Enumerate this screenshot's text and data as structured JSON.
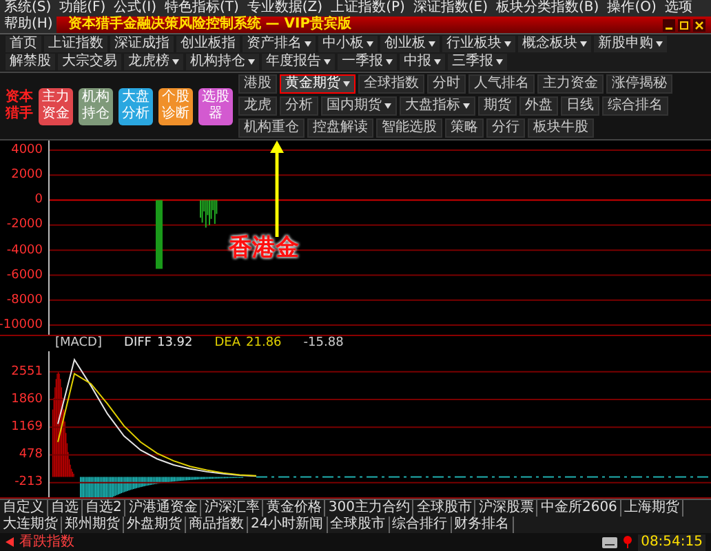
{
  "menu": [
    "系统(S)",
    "功能(F)",
    "公式(I)",
    "特色指标(T)",
    "专业数据(Z)",
    "上证指数(P)",
    "深证指数(E)",
    "板块分类指数(B)",
    "操作(O)",
    "选项",
    "帮助(H)"
  ],
  "window": {
    "title": "资本猎手金融决策风险控制系统 — VIP贵宾版"
  },
  "nav": [
    {
      "label": "首页",
      "dropdown": false
    },
    {
      "label": "上证指数",
      "dropdown": false
    },
    {
      "label": "深证成指",
      "dropdown": false
    },
    {
      "label": "创业板指",
      "dropdown": false
    },
    {
      "label": "资产排名",
      "dropdown": true
    },
    {
      "label": "中小板",
      "dropdown": true
    },
    {
      "label": "创业板",
      "dropdown": true
    },
    {
      "label": "行业板块",
      "dropdown": true
    },
    {
      "label": "概念板块",
      "dropdown": true
    },
    {
      "label": "新股申购",
      "dropdown": true
    },
    {
      "label": "解禁股",
      "dropdown": false
    },
    {
      "label": "大宗交易",
      "dropdown": false
    },
    {
      "label": "龙虎榜",
      "dropdown": true
    },
    {
      "label": "机构持仓",
      "dropdown": true
    },
    {
      "label": "年度报告",
      "dropdown": true
    },
    {
      "label": "一季报",
      "dropdown": true
    },
    {
      "label": "中报",
      "dropdown": true
    },
    {
      "label": "三季报",
      "dropdown": true
    }
  ],
  "logo_text": [
    "资本",
    "猎手"
  ],
  "feature_buttons": [
    {
      "lines": [
        "主力",
        "资金"
      ],
      "color": "#e0474c"
    },
    {
      "lines": [
        "机构",
        "持仓"
      ],
      "color": "#7f9a7a"
    },
    {
      "lines": [
        "大盘",
        "分析"
      ],
      "color": "#2aa7e0"
    },
    {
      "lines": [
        "个股",
        "诊断"
      ],
      "color": "#f0902a"
    },
    {
      "lines": [
        "选股",
        "器"
      ],
      "color": "#d35ad0"
    }
  ],
  "quick_buttons": [
    {
      "label": "港股",
      "dropdown": false,
      "selected": false
    },
    {
      "label": "黄金期货",
      "dropdown": true,
      "selected": true
    },
    {
      "label": "全球指数",
      "dropdown": false,
      "selected": false
    },
    {
      "label": "分时",
      "dropdown": false,
      "selected": false
    },
    {
      "label": "人气排名",
      "dropdown": false,
      "selected": false
    },
    {
      "label": "主力资金",
      "dropdown": false,
      "selected": false
    },
    {
      "label": "涨停揭秘",
      "dropdown": false,
      "selected": false
    },
    {
      "label": "龙虎",
      "dropdown": false,
      "selected": false
    },
    {
      "label": "分析",
      "dropdown": false,
      "selected": false
    },
    {
      "label": "国内期货",
      "dropdown": true,
      "selected": false
    },
    {
      "label": "大盘指标",
      "dropdown": true,
      "selected": false
    },
    {
      "label": "期货",
      "dropdown": false,
      "selected": false
    },
    {
      "label": "外盘",
      "dropdown": false,
      "selected": false
    },
    {
      "label": "日线",
      "dropdown": false,
      "selected": false
    },
    {
      "label": "综合排名",
      "dropdown": false,
      "selected": false
    },
    {
      "label": "机构重仓",
      "dropdown": false,
      "selected": false
    },
    {
      "label": "控盘解读",
      "dropdown": false,
      "selected": false
    },
    {
      "label": "智能选股",
      "dropdown": false,
      "selected": false
    },
    {
      "label": "策略",
      "dropdown": false,
      "selected": false
    },
    {
      "label": "分行",
      "dropdown": false,
      "selected": false
    },
    {
      "label": "板块牛股",
      "dropdown": false,
      "selected": false
    }
  ],
  "main_chart": {
    "y_labels": [
      "4000",
      "2000",
      "0",
      "-2000",
      "-4000",
      "-6000",
      "-8000",
      "-10000"
    ]
  },
  "annotation": {
    "label": "香港金"
  },
  "macd": {
    "title": "[MACD]",
    "diff_value": "13.92",
    "dea_value": "21.86",
    "value": "-15.88",
    "chart_data": {
      "type": "line",
      "grid": true,
      "ylim": [
        -577,
        3060
      ],
      "yticks": [
        {
          "value": 2551,
          "label": "2551"
        },
        {
          "value": 1860,
          "label": "1860"
        },
        {
          "value": 1169,
          "label": "1169"
        },
        {
          "value": 478,
          "label": "478"
        },
        {
          "value": -213,
          "label": "-213"
        }
      ],
      "series": [
        {
          "name": "DIFF",
          "color": "#e6e6e6",
          "values": [
            1250,
            2850,
            2200,
            1500,
            950,
            600,
            380,
            230,
            130,
            60,
            10,
            -30,
            -50,
            null,
            null,
            null,
            null,
            null,
            null,
            null,
            null,
            null,
            null,
            null,
            null,
            null,
            null,
            null,
            null,
            null,
            null,
            null,
            null,
            null,
            null,
            null,
            null,
            null,
            null,
            null
          ]
        },
        {
          "name": "DEA",
          "color": "#e0d000",
          "values": [
            800,
            2500,
            2250,
            1750,
            1200,
            800,
            520,
            330,
            190,
            100,
            30,
            -20,
            -40,
            null,
            null,
            null,
            null,
            null,
            null,
            null,
            null,
            null,
            null,
            null,
            null,
            null,
            null,
            null,
            null,
            null,
            null,
            null,
            null,
            null,
            null,
            null,
            null,
            null,
            null,
            null
          ]
        }
      ]
    }
  },
  "bottom_tabs": [
    "自定义",
    "自选",
    "自选2",
    "沪港通资金",
    "沪深汇率",
    "黄金价格",
    "300主力合约",
    "全球股市",
    "沪深股票",
    "中金所2606",
    "上海期货",
    "大连期货",
    "郑州期货",
    "外盘期货",
    "商品指数",
    "24小时新闻",
    "全球股市",
    "综合排行",
    "财务排名"
  ],
  "status": {
    "left": "看跌指数",
    "time": "08:54:15"
  }
}
